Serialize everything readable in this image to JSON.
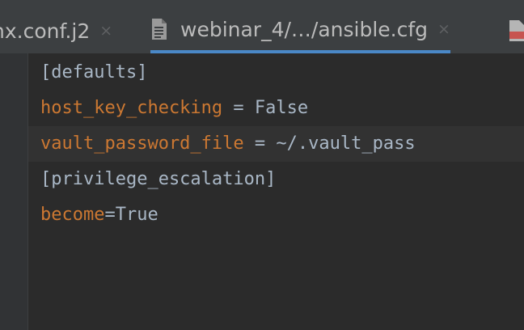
{
  "tabs": [
    {
      "label": "nx.conf.j2",
      "active": false,
      "close": "×"
    },
    {
      "label": "webinar_4/…/ansible.cfg",
      "active": true,
      "close": "×",
      "icon": "text-file-icon"
    },
    {
      "label": "",
      "active": false,
      "icon": "yaml-file-icon"
    }
  ],
  "editor": {
    "lines": [
      {
        "type": "section",
        "text": "[defaults]"
      },
      {
        "type": "pair",
        "key": "host_key_checking",
        "separator": " = ",
        "value": "False"
      },
      {
        "type": "pair",
        "key": "vault_password_file",
        "separator": " = ",
        "value": "~/.vault_pass",
        "current": true
      },
      {
        "type": "section",
        "text": "[privilege_escalation]"
      },
      {
        "type": "pair",
        "key": "become",
        "separator": "=",
        "value": "True"
      }
    ]
  },
  "colors": {
    "background": "#2b2b2b",
    "tab_bar": "#3c3f41",
    "active_tab_underline": "#4a88c7",
    "key": "#cc7832",
    "text": "#a9b7c6"
  }
}
